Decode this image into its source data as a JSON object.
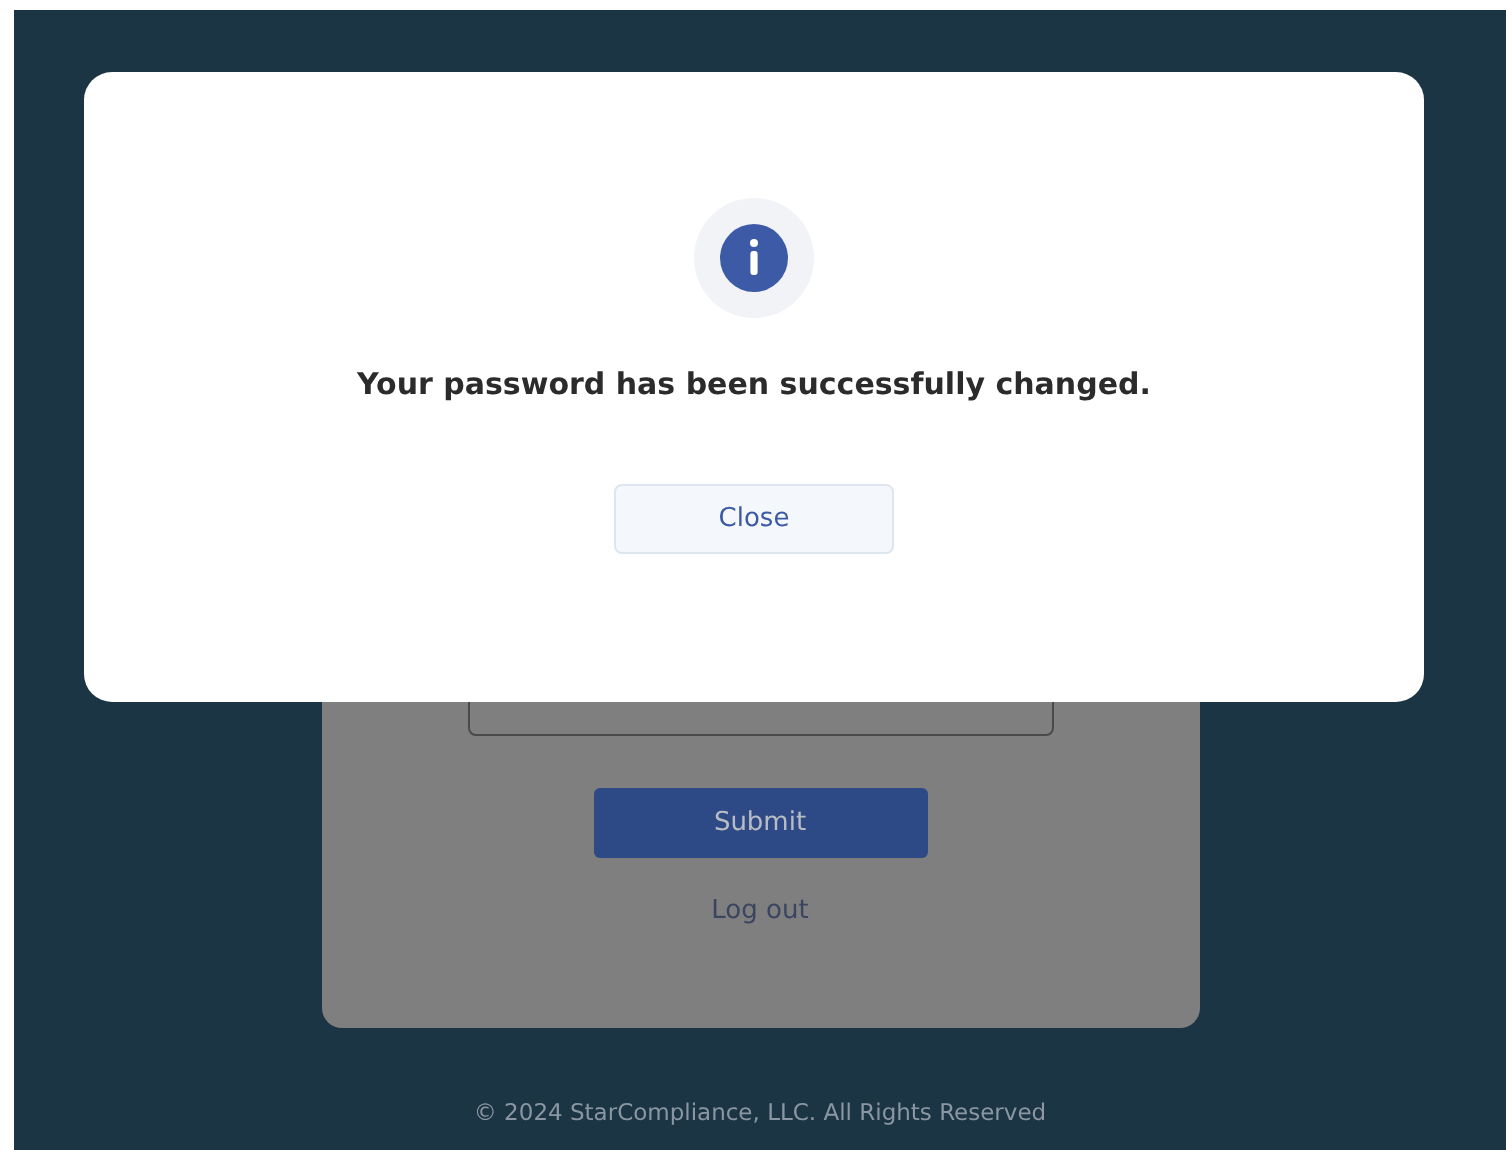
{
  "page": {
    "submit_button": "Submit",
    "logout_link": "Log out",
    "footer": "© 2024 StarCompliance, LLC. All Rights Reserved"
  },
  "dialog": {
    "message": "Your password has been successfully changed.",
    "close_button": "Close"
  }
}
